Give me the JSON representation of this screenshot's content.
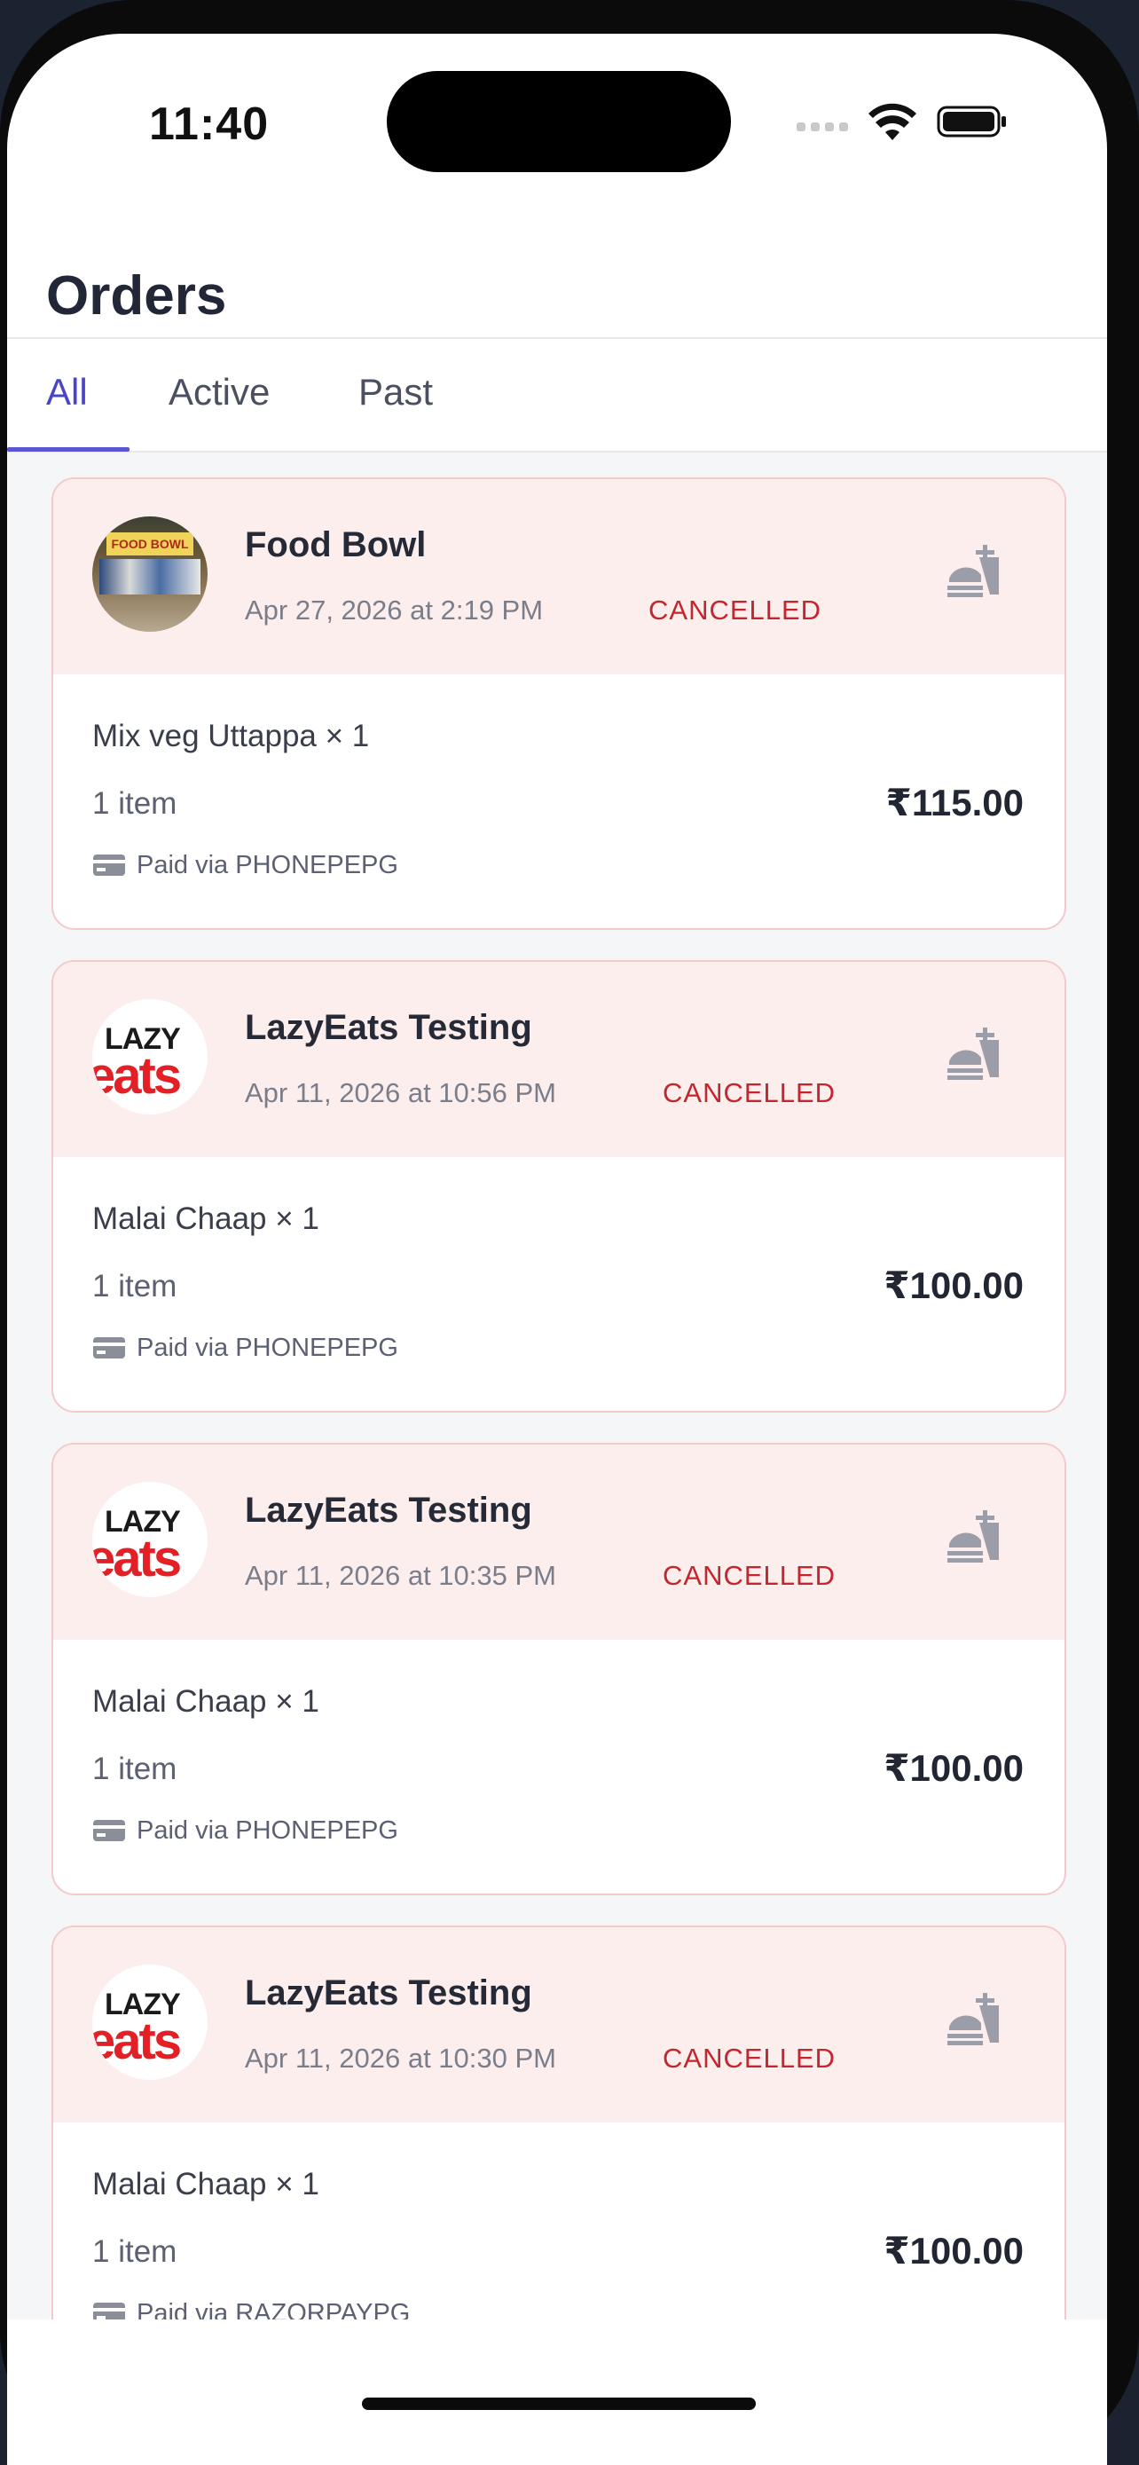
{
  "status_bar": {
    "time": "11:40"
  },
  "header": {
    "title": "Orders"
  },
  "tabs": [
    {
      "label": "All",
      "active": true
    },
    {
      "label": "Active",
      "active": false
    },
    {
      "label": "Past",
      "active": false
    }
  ],
  "colors": {
    "accent": "#5b54d6",
    "cancelled": "#c4262e",
    "card_header_bg": "#fdeeee",
    "card_border": "#f5c9cb"
  },
  "orders": [
    {
      "restaurant": "Food Bowl",
      "logo": "food-bowl-photo",
      "date": "Apr 27, 2026 at 2:19 PM",
      "status": "CANCELLED",
      "item": "Mix veg Uttappa × 1",
      "count": "1 item",
      "price": "₹115.00",
      "payment": "Paid via PHONEPEPG"
    },
    {
      "restaurant": "LazyEats Testing",
      "logo": "lazyeats-logo",
      "date": "Apr 11, 2026 at 10:56 PM",
      "status": "CANCELLED",
      "item": "Malai Chaap × 1",
      "count": "1 item",
      "price": "₹100.00",
      "payment": "Paid via PHONEPEPG"
    },
    {
      "restaurant": "LazyEats Testing",
      "logo": "lazyeats-logo",
      "date": "Apr 11, 2026 at 10:35 PM",
      "status": "CANCELLED",
      "item": "Malai Chaap × 1",
      "count": "1 item",
      "price": "₹100.00",
      "payment": "Paid via PHONEPEPG"
    },
    {
      "restaurant": "LazyEats Testing",
      "logo": "lazyeats-logo",
      "date": "Apr 11, 2026 at 10:30 PM",
      "status": "CANCELLED",
      "item": "Malai Chaap × 1",
      "count": "1 item",
      "price": "₹100.00",
      "payment": "Paid via RAZORPAYPG"
    }
  ],
  "logo_text": {
    "food_bowl_sign": "FOOD BOWL",
    "lazy_top": "LAZY",
    "lazy_bottom": "eats"
  },
  "icons": {
    "cooking": "serving-cloche-icon",
    "payment": "credit-card-icon",
    "wifi": "wifi-icon",
    "battery": "battery-icon"
  }
}
